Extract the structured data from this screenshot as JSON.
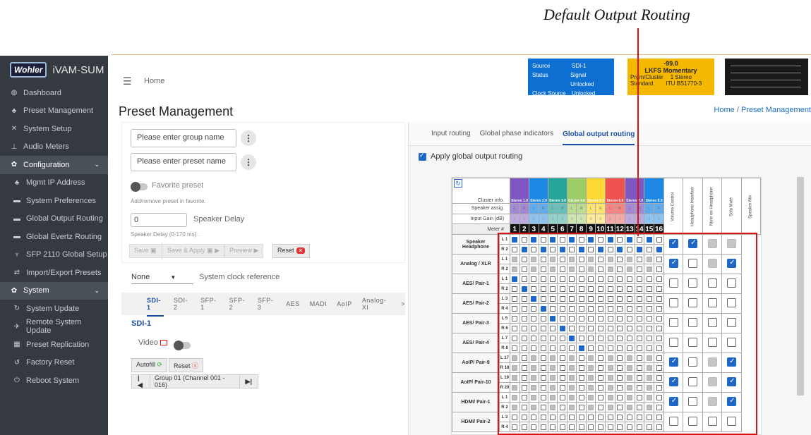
{
  "annotation": {
    "title": "Default Output Routing"
  },
  "sidebar": {
    "logo": "Wohler",
    "product": "iVAM-SUM",
    "items": [
      {
        "label": "Dashboard",
        "icon": "dashboard-icon",
        "glyph": "◍"
      },
      {
        "label": "Preset Management",
        "icon": "users-icon",
        "glyph": "♣"
      },
      {
        "label": "System Setup",
        "icon": "tools-icon",
        "glyph": "✕"
      },
      {
        "label": "Audio Meters",
        "icon": "bar-chart-icon",
        "glyph": "⊥"
      },
      {
        "label": "Configuration",
        "icon": "gear-icon",
        "glyph": "✿"
      },
      {
        "label": "Mgmt IP Address",
        "icon": "network-icon",
        "glyph": "♣"
      },
      {
        "label": "System Preferences",
        "icon": "monitor-icon",
        "glyph": "▬"
      },
      {
        "label": "Global Output Routing",
        "icon": "monitor-icon",
        "glyph": "▬"
      },
      {
        "label": "Global Evertz Routing",
        "icon": "monitor-icon",
        "glyph": "▬"
      },
      {
        "label": "SFP 2110 Global Setup",
        "icon": "plug-icon",
        "glyph": "♆"
      },
      {
        "label": "Import/Export Presets",
        "icon": "exchange-icon",
        "glyph": "⇄"
      },
      {
        "label": "System",
        "icon": "gears-icon",
        "glyph": "✿"
      },
      {
        "label": "System Update",
        "icon": "sync-icon",
        "glyph": "↻"
      },
      {
        "label": "Remote System Update",
        "icon": "satellite-icon",
        "glyph": "✈"
      },
      {
        "label": "Preset Replication",
        "icon": "copy-icon",
        "glyph": "▦"
      },
      {
        "label": "Factory Reset",
        "icon": "undo-icon",
        "glyph": "↺"
      },
      {
        "label": "Reboot System",
        "icon": "power-icon",
        "glyph": "⏻"
      }
    ]
  },
  "topbar": {
    "home": "Home",
    "status": {
      "rows": [
        [
          "Source",
          "SDI-1"
        ],
        [
          "Status",
          "Signal Unlocked"
        ],
        [
          "Clock Source",
          "Unlocked"
        ]
      ]
    },
    "lkfs": {
      "value": "-99.0",
      "label": "LKFS   Momentary",
      "prgm_key": "Prgm/Cluster",
      "prgm_val": "1  Stereo",
      "std_key": "Standard",
      "std_val": "ITU BS1770-3"
    }
  },
  "page": {
    "title": "Preset Management",
    "crumb_home": "Home",
    "crumb_sep": "/",
    "crumb_current": "Preset Management"
  },
  "preset": {
    "group_placeholder": "Please enter group name",
    "preset_placeholder": "Please enter preset name",
    "favorite_label": "Favorite preset",
    "favorite_hint": "Add/remove preset in favorite.",
    "delay_value": "0",
    "delay_label": "Speaker Delay",
    "delay_hint": "Speaker Delay (0-170 ms) .",
    "save": "Save",
    "save_apply": "Save & Apply",
    "preview": "Preview",
    "reset": "Reset"
  },
  "clock": {
    "selected": "None",
    "label": "System clock reference"
  },
  "input_tabs": [
    "SDI-1",
    "SDI-2",
    "SFP-1",
    "SFP-2",
    "SFP-3",
    "AES",
    "MADI",
    "AoIP",
    "Analog-XI",
    ">"
  ],
  "sdi": {
    "title": "SDI-1",
    "video_label": "Video",
    "autofill": "Autofill",
    "reset": "Reset",
    "group": "Group 01 (Channel 001 - 016)"
  },
  "right_tabs": [
    "Input routing",
    "Global phase indicators",
    "Global output routing"
  ],
  "apply_label": "Apply global output routing",
  "matrix": {
    "info_labels": [
      "Cluster info.",
      "Speaker assig.",
      "Input Gain (dB)",
      "Meter #"
    ],
    "cluster_colors": [
      "#7e57c2",
      "#1e88e5",
      "#26a69a",
      "#9ccc65",
      "#fdd835",
      "#ef5350"
    ],
    "meters": [
      "1",
      "2",
      "3",
      "4",
      "5",
      "6",
      "7",
      "8",
      "9",
      "10",
      "11",
      "12",
      "13",
      "14",
      "15",
      "16"
    ],
    "right_headers": [
      "Volume Control",
      "Headphone Insertion",
      "Mute on Headphone",
      "Solo Mute",
      "Speaker Mix"
    ],
    "rows": [
      {
        "name": "Speaker Headphone",
        "chans": [
          [
            "L",
            "1"
          ],
          [
            "R",
            "2"
          ]
        ],
        "right": [
          "on",
          "on",
          "gr",
          "gr"
        ]
      },
      {
        "name": "Analog / XLR",
        "chans": [
          [
            "L",
            "1"
          ],
          [
            "R",
            "2"
          ]
        ],
        "right": [
          "on",
          "off",
          "gr",
          "on"
        ]
      },
      {
        "name": "AES/ Pair-1",
        "chans": [
          [
            "L",
            "1"
          ],
          [
            "R",
            "2"
          ]
        ],
        "right": [
          "off",
          "off",
          "off",
          "off"
        ]
      },
      {
        "name": "AES/ Pair-2",
        "chans": [
          [
            "L",
            "3"
          ],
          [
            "R",
            "4"
          ]
        ],
        "right": [
          "off",
          "off",
          "off",
          "off"
        ]
      },
      {
        "name": "AES/ Pair-3",
        "chans": [
          [
            "L",
            "5"
          ],
          [
            "R",
            "6"
          ]
        ],
        "right": [
          "off",
          "off",
          "off",
          "off"
        ]
      },
      {
        "name": "AES/ Pair-4",
        "chans": [
          [
            "L",
            "7"
          ],
          [
            "R",
            "8"
          ]
        ],
        "right": [
          "off",
          "off",
          "off",
          "off"
        ]
      },
      {
        "name": "AoIP/ Pair-9",
        "chans": [
          [
            "L",
            "17"
          ],
          [
            "R",
            "18"
          ]
        ],
        "right": [
          "on",
          "off",
          "gr",
          "on"
        ]
      },
      {
        "name": "AoIP/ Pair-10",
        "chans": [
          [
            "L",
            "19"
          ],
          [
            "R",
            "20"
          ]
        ],
        "right": [
          "on",
          "off",
          "gr",
          "on"
        ]
      },
      {
        "name": "HDMI/ Pair-1",
        "chans": [
          [
            "L",
            "1"
          ],
          [
            "R",
            "2"
          ]
        ],
        "right": [
          "on",
          "off",
          "gr",
          "on"
        ]
      },
      {
        "name": "HDMI/ Pair-2",
        "chans": [
          [
            "L",
            "3"
          ],
          [
            "R",
            "4"
          ]
        ],
        "right": [
          "off",
          "off",
          "off",
          "off"
        ]
      }
    ]
  }
}
